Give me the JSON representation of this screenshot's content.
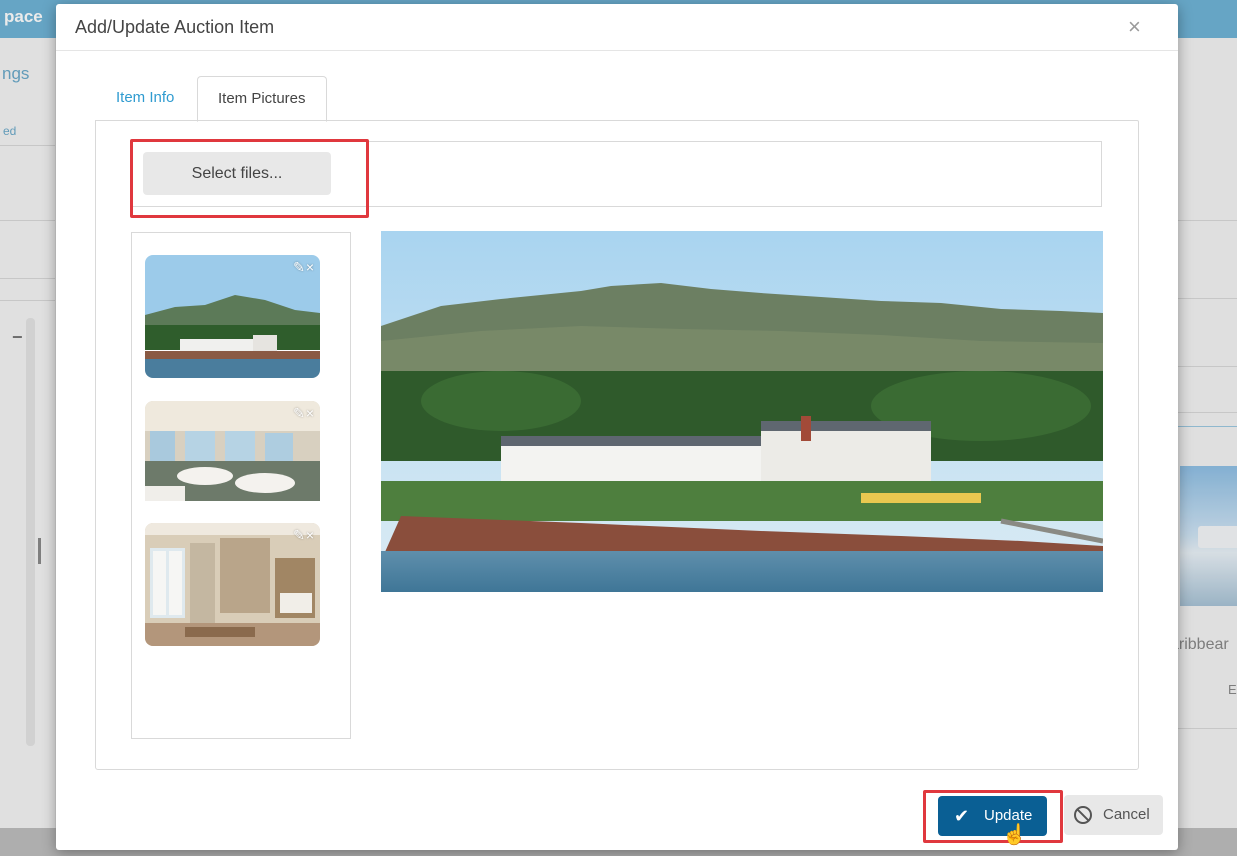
{
  "background_app": {
    "brand_fragment": "pace",
    "nav_fragment": "ngs",
    "nav_subfragment": "ed",
    "card_title_fragment": "aribbear",
    "card_meta_fragment": "E"
  },
  "modal": {
    "title": "Add/Update Auction Item",
    "close_glyph": "×",
    "tabs": [
      {
        "label": "Item Info",
        "active": false
      },
      {
        "label": "Item Pictures",
        "active": true
      }
    ],
    "upload": {
      "select_label": "Select files..."
    },
    "thumbnails": [
      {
        "description": "hotel-exterior",
        "edit_glyph": "✎",
        "remove_glyph": "×"
      },
      {
        "description": "dining-room",
        "edit_glyph": "✎",
        "remove_glyph": "×"
      },
      {
        "description": "guest-room",
        "edit_glyph": "✎",
        "remove_glyph": "×"
      }
    ],
    "buttons": {
      "update_label": "Update",
      "update_glyph": "✔",
      "cancel_label": "Cancel"
    }
  },
  "colors": {
    "primary": "#0a5f94",
    "link": "#2f9bd0",
    "highlight": "#e0383e"
  }
}
